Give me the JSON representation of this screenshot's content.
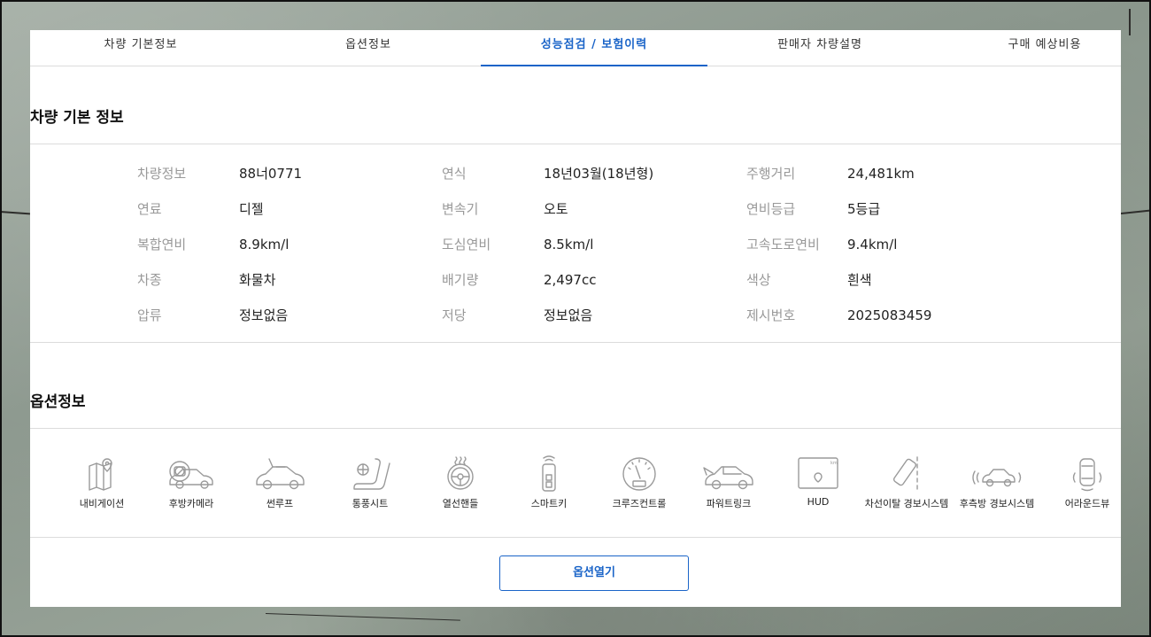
{
  "tabs": [
    {
      "label": "차량 기본정보"
    },
    {
      "label": "옵션정보"
    },
    {
      "label": "성능점검 / 보험이력"
    },
    {
      "label": "판매자 차량설명"
    },
    {
      "label": "구매 예상비용"
    }
  ],
  "basic_info": {
    "title": "차량 기본 정보",
    "rows": [
      [
        {
          "label": "차량정보",
          "value": "88너0771"
        },
        {
          "label": "연식",
          "value": "18년03월(18년형)"
        },
        {
          "label": "주행거리",
          "value": "24,481km"
        }
      ],
      [
        {
          "label": "연료",
          "value": "디젤"
        },
        {
          "label": "변속기",
          "value": "오토"
        },
        {
          "label": "연비등급",
          "value": "5등급"
        }
      ],
      [
        {
          "label": "복합연비",
          "value": "8.9km/l"
        },
        {
          "label": "도심연비",
          "value": "8.5km/l"
        },
        {
          "label": "고속도로연비",
          "value": "9.4km/l"
        }
      ],
      [
        {
          "label": "차종",
          "value": "화물차"
        },
        {
          "label": "배기량",
          "value": "2,497cc"
        },
        {
          "label": "색상",
          "value": "흰색"
        }
      ],
      [
        {
          "label": "압류",
          "value": "정보없음"
        },
        {
          "label": "저당",
          "value": "정보없음"
        },
        {
          "label": "제시번호",
          "value": "2025083459"
        }
      ]
    ]
  },
  "options": {
    "title": "옵션정보",
    "items": [
      {
        "label": "내비게이션",
        "icon": "navigation-icon"
      },
      {
        "label": "후방카메라",
        "icon": "rear-camera-icon"
      },
      {
        "label": "썬루프",
        "icon": "sunroof-icon"
      },
      {
        "label": "통풍시트",
        "icon": "ventilated-seat-icon"
      },
      {
        "label": "열선핸들",
        "icon": "heated-steering-icon"
      },
      {
        "label": "스마트키",
        "icon": "smart-key-icon"
      },
      {
        "label": "크루즈컨트롤",
        "icon": "cruise-control-icon"
      },
      {
        "label": "파워트링크",
        "icon": "power-trunk-icon"
      },
      {
        "label": "HUD",
        "icon": "hud-icon"
      },
      {
        "label": "차선이탈 경보시스템",
        "icon": "lane-departure-icon"
      },
      {
        "label": "후측방 경보시스템",
        "icon": "blind-spot-icon"
      },
      {
        "label": "어라운드뷰",
        "icon": "around-view-icon"
      }
    ],
    "open_button": "옵션열기"
  },
  "colors": {
    "accent": "#1a64c8",
    "label": "#999999",
    "value": "#222222",
    "divider": "#dcdcdc"
  }
}
